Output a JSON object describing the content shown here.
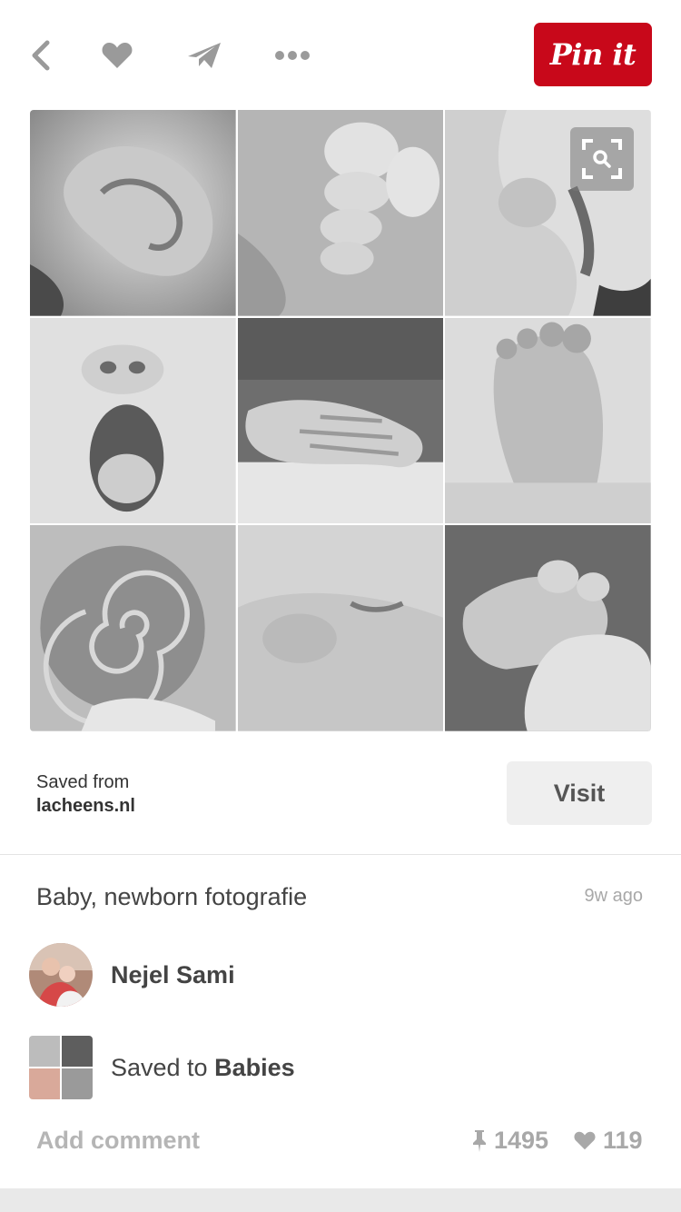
{
  "topbar": {
    "back_icon": "chevron-left-icon",
    "like_icon": "heart-icon",
    "send_icon": "paper-plane-icon",
    "more_icon": "more-dots-icon",
    "pin_button": "Pin it",
    "pin_color": "#c8081a"
  },
  "pin": {
    "images": [
      "ear",
      "toes",
      "sleeping-face",
      "yawning-mouth",
      "tiny-hands",
      "foot-sole",
      "hair-swirl",
      "closed-eye",
      "hand-grip"
    ],
    "lens_icon": "visual-search-icon"
  },
  "source": {
    "label": "Saved from",
    "domain": "lacheens.nl",
    "visit_label": "Visit"
  },
  "details": {
    "description": "Baby, newborn fotografie",
    "time_ago": "9w ago",
    "user_name": "Nejel Sami",
    "saved_prefix": "Saved to ",
    "board_name": "Babies"
  },
  "footer": {
    "add_comment": "Add comment",
    "repin_count": "1495",
    "like_count": "119"
  }
}
